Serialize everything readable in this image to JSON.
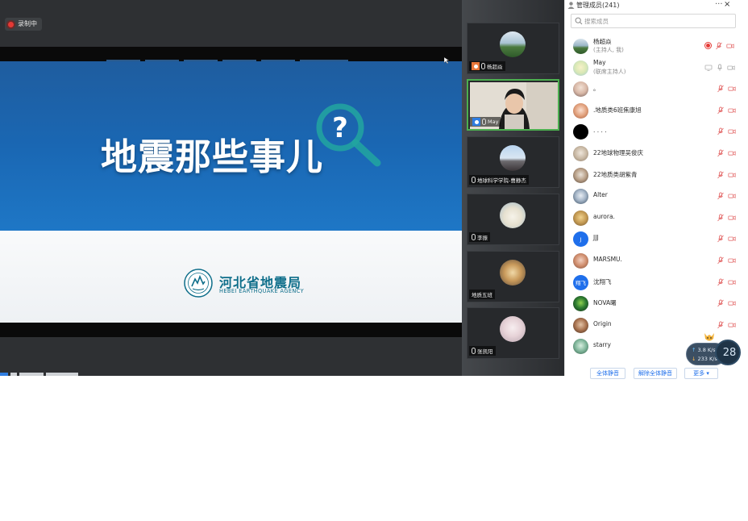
{
  "recording": {
    "label": "录制中"
  },
  "slide": {
    "title": "地震那些事儿",
    "agency_cn": "河北省地震局",
    "agency_en": "HEBEI EARTHQUAKE AGENCY"
  },
  "video_tiles": [
    {
      "name": "杨超焱"
    },
    {
      "name": "May"
    },
    {
      "name": "地球科学学院-曹静杰"
    },
    {
      "name": "李振"
    },
    {
      "name": "地质五班"
    },
    {
      "name": "张凯阳"
    }
  ],
  "member_panel": {
    "title": "管理成员(241)",
    "more": "···",
    "close": "×",
    "search_placeholder": "搜索成员",
    "members": [
      {
        "name": "杨超焱",
        "role": "(主持人, 我)"
      },
      {
        "name": "May",
        "role": "(联席主持人)"
      },
      {
        "name": "。"
      },
      {
        "name": ".地质类6班焦康旭"
      },
      {
        "name": ". . . ."
      },
      {
        "name": "22地球物理吴俊庆"
      },
      {
        "name": "22地质类胡紫青"
      },
      {
        "name": "Alter"
      },
      {
        "name": "aurora."
      },
      {
        "name": "JJJ",
        "avatar_letter": "J"
      },
      {
        "name": "MARSMU."
      },
      {
        "name": "沈翔飞",
        "avatar_letter": "翔飞"
      },
      {
        "name": "NOVA曙"
      },
      {
        "name": "Origin"
      },
      {
        "name": "starry"
      }
    ],
    "footer": {
      "mute_all": "全体静音",
      "unmute_all": "解除全体静音",
      "more": "更多 ▾"
    }
  },
  "speed_widget": {
    "upload": "3.8 K/s",
    "download": "233 K/s",
    "badge": "28"
  },
  "colors": {
    "slide_blue": "#1a67b3",
    "agency_teal": "#0e6e8a",
    "accent_blue": "#1f6feb",
    "record_red": "#e53935",
    "active_green": "#4caf50"
  }
}
